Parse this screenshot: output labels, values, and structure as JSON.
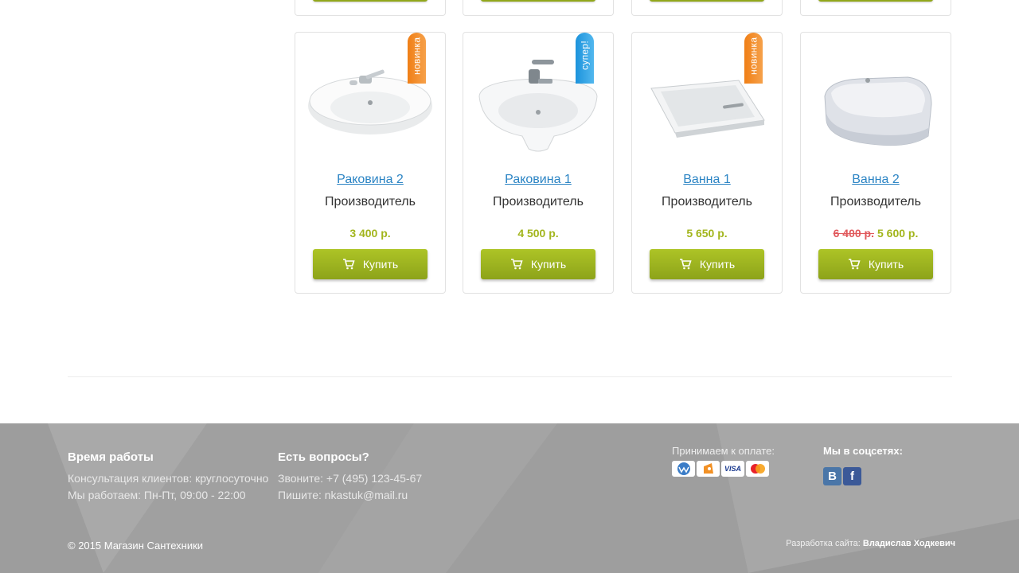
{
  "products": [
    {
      "title": "Раковина 2",
      "maker": "Производитель",
      "price": "3 400 р.",
      "old_price": "",
      "badge": "новинка",
      "badge_color": "#f07f16",
      "image": "sink"
    },
    {
      "title": "Раковина 1",
      "maker": "Производитель",
      "price": "4 500 р.",
      "old_price": "",
      "badge": "супер!",
      "badge_color": "#1c93dc",
      "image": "sink"
    },
    {
      "title": "Ванна 1",
      "maker": "Производитель",
      "price": "5 650 р.",
      "old_price": "",
      "badge": "новинка",
      "badge_color": "#f07f16",
      "image": "bathtub"
    },
    {
      "title": "Ванна 2",
      "maker": "Производитель",
      "price": "5 600 р.",
      "old_price": "6 400 р.",
      "badge": "",
      "badge_color": "",
      "image": "corner-bathtub"
    }
  ],
  "buy_label": "Купить",
  "footer": {
    "hours": {
      "title": "Время работы",
      "line1": "Консультация клиентов: круглосуточно",
      "line2": "Мы работаем: Пн-Пт, 09:00 - 22:00"
    },
    "questions": {
      "title": "Есть вопросы?",
      "line1": "Звоните: +7 (495) 123-45-67",
      "line2": "Пишите: nkastuk@mail.ru"
    },
    "payment_label": "Принимаем к оплате:",
    "payment_icons": [
      "webmoney-icon",
      "yandex-money-icon",
      "visa-icon",
      "mastercard-icon"
    ],
    "visa_text": "VISA",
    "social_label": "Мы в соцсетях:",
    "vk_text": "В",
    "fb_text": "f",
    "copyright": "© 2015 Магазин Сантехники",
    "dev_label": "Разработка сайта:",
    "dev_name": "Владислав Ходкевич"
  },
  "colors": {
    "accent_green": "#a2b51c",
    "link_blue": "#2b84c4",
    "old_price_red": "#e0585b",
    "footer_bg": "#a6a6a6"
  }
}
